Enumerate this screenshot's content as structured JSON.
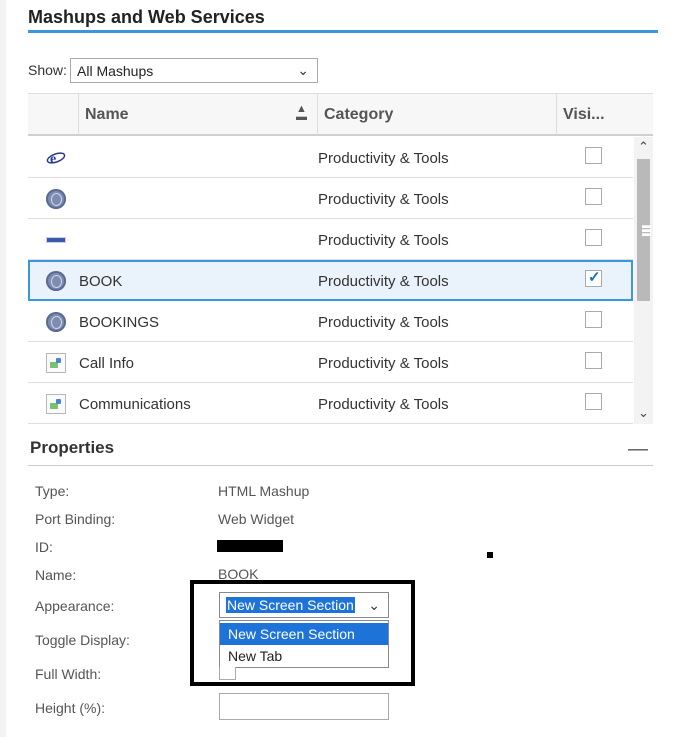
{
  "panel": {
    "title": "Mashups and Web Services"
  },
  "filter": {
    "label": "Show:",
    "value": "All Mashups"
  },
  "grid": {
    "columns": {
      "name": "Name",
      "category": "Category",
      "visible": "Visi..."
    },
    "rows": [
      {
        "name": "",
        "category": "Productivity & Tools",
        "icon": "ie-logo-icon",
        "checked": false
      },
      {
        "name": "",
        "category": "Productivity & Tools",
        "icon": "globe-icon",
        "checked": false
      },
      {
        "name": "",
        "category": "Productivity & Tools",
        "icon": "small-logo-icon",
        "checked": false
      },
      {
        "name": "BOOK",
        "category": "Productivity & Tools",
        "icon": "globe-icon",
        "checked": true,
        "selected": true
      },
      {
        "name": "BOOKINGS",
        "category": "Productivity & Tools",
        "icon": "globe-icon",
        "checked": false
      },
      {
        "name": "Call Info",
        "category": "Productivity & Tools",
        "icon": "broken-image-icon",
        "checked": false
      },
      {
        "name": "Communications",
        "category": "Productivity & Tools",
        "icon": "broken-image-icon",
        "checked": false
      }
    ]
  },
  "properties": {
    "title": "Properties",
    "type_label": "Type:",
    "type_value": "HTML Mashup",
    "port_label": "Port Binding:",
    "port_value": "Web Widget",
    "id_label": "ID:",
    "name_label": "Name:",
    "name_value": "BOOK",
    "appearance_label": "Appearance:",
    "appearance_value": "New Screen Section",
    "appearance_options": [
      "New Screen Section",
      "New Tab"
    ],
    "toggle_label": "Toggle Display:",
    "fullwidth_label": "Full Width:",
    "height_label": "Height (%):"
  },
  "colors": {
    "accent": "#3a96dd",
    "selection": "#1e73d8",
    "selected_row_bg": "#eaf2fb"
  }
}
